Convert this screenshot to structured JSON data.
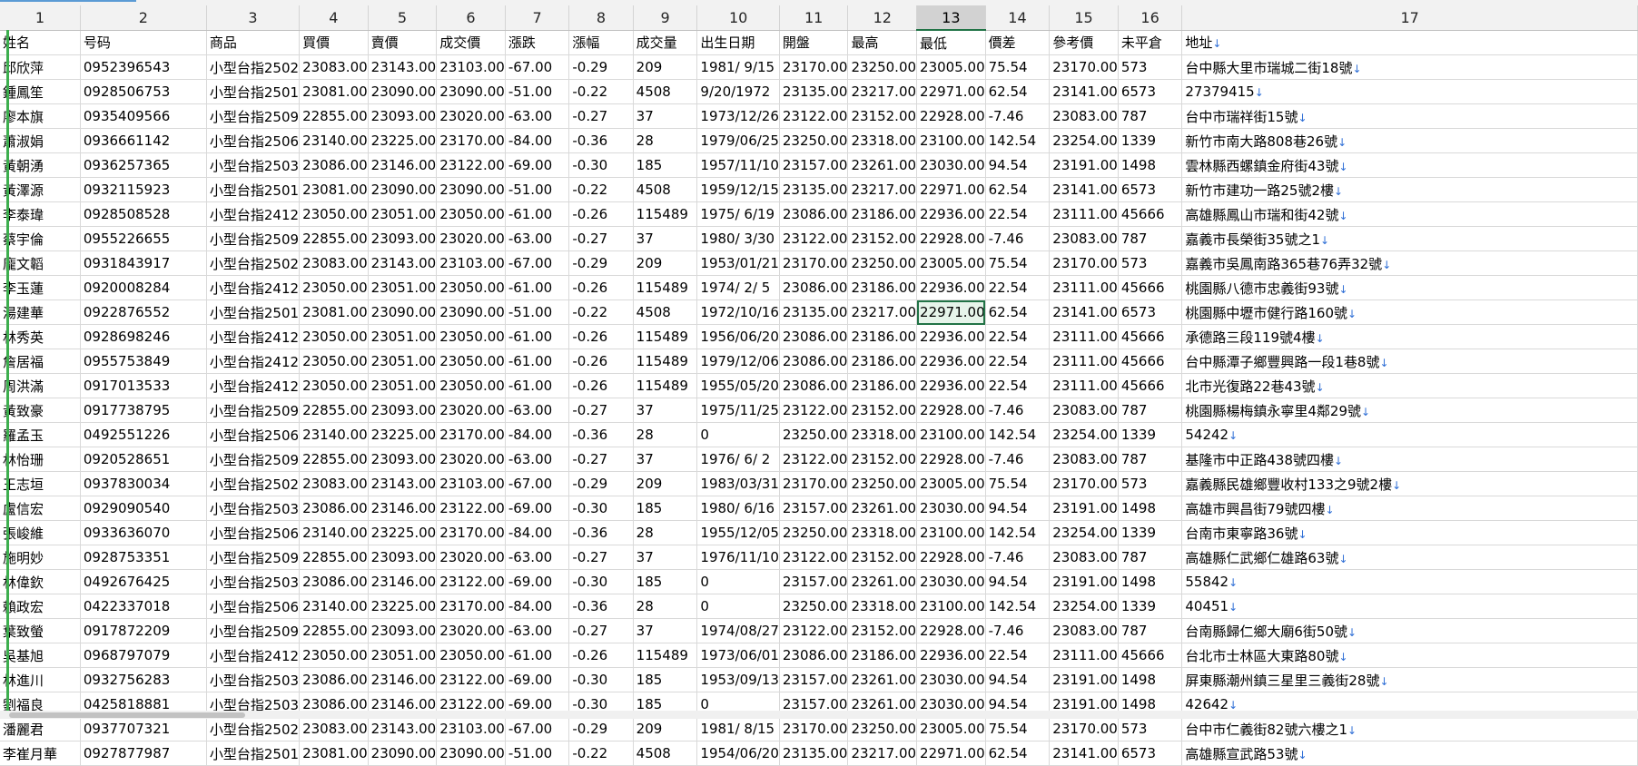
{
  "column_numbers": [
    "1",
    "2",
    "3",
    "4",
    "5",
    "6",
    "7",
    "8",
    "9",
    "10",
    "11",
    "12",
    "13",
    "14",
    "15",
    "16",
    "17"
  ],
  "selected_column": 12,
  "selected_cell": {
    "row": 10,
    "col": 12
  },
  "header_row": [
    "姓名",
    "号码",
    "商品",
    "買價",
    "賣價",
    "成交價",
    "漲跌",
    "漲幅",
    "成交量",
    "出生日期",
    "開盤",
    "最高",
    "最低",
    "價差",
    "參考價",
    "未平倉",
    "地址"
  ],
  "rows": [
    [
      "邱欣萍",
      "0952396543",
      "小型台指2502",
      "23083.00",
      "23143.00",
      "23103.00",
      "-67.00",
      "-0.29",
      "209",
      "1981/ 9/15",
      "23170.00",
      "23250.00",
      "23005.00",
      "75.54",
      "23170.00",
      "573",
      "台中縣大里市瑞城二街18號"
    ],
    [
      "鍾鳳笙",
      "0928506753",
      "小型台指2501",
      "23081.00",
      "23090.00",
      "23090.00",
      "-51.00",
      "-0.22",
      "4508",
      "9/20/1972",
      "23135.00",
      "23217.00",
      "22971.00",
      "62.54",
      "23141.00",
      "6573",
      "27379415"
    ],
    [
      "廖本旗",
      "0935409566",
      "小型台指2509",
      "22855.00",
      "23093.00",
      "23020.00",
      "-63.00",
      "-0.27",
      "37",
      "1973/12/26",
      "23122.00",
      "23152.00",
      "22928.00",
      "-7.46",
      "23083.00",
      "787",
      "台中市瑞祥街15號"
    ],
    [
      "蕭淑娟",
      "0936661142",
      "小型台指2506",
      "23140.00",
      "23225.00",
      "23170.00",
      "-84.00",
      "-0.36",
      "28",
      "1979/06/25",
      "23250.00",
      "23318.00",
      "23100.00",
      "142.54",
      "23254.00",
      "1339",
      "新竹市南大路808巷26號"
    ],
    [
      "黃朝湧",
      "0936257365",
      "小型台指2503",
      "23086.00",
      "23146.00",
      "23122.00",
      "-69.00",
      "-0.30",
      "185",
      "1957/11/10",
      "23157.00",
      "23261.00",
      "23030.00",
      "94.54",
      "23191.00",
      "1498",
      "雲林縣西螺鎮金府街43號"
    ],
    [
      "黃澤源",
      "0932115923",
      "小型台指2501",
      "23081.00",
      "23090.00",
      "23090.00",
      "-51.00",
      "-0.22",
      "4508",
      "1959/12/15",
      "23135.00",
      "23217.00",
      "22971.00",
      "62.54",
      "23141.00",
      "6573",
      "新竹市建功一路25號2樓"
    ],
    [
      "李泰瑋",
      "0928508528",
      "小型台指2412",
      "23050.00",
      "23051.00",
      "23050.00",
      "-61.00",
      "-0.26",
      "115489",
      "1975/ 6/19",
      "23086.00",
      "23186.00",
      "22936.00",
      "22.54",
      "23111.00",
      "45666",
      "高雄縣鳳山市瑞和街42號"
    ],
    [
      "蔡宇倫",
      "0955226655",
      "小型台指2509",
      "22855.00",
      "23093.00",
      "23020.00",
      "-63.00",
      "-0.27",
      "37",
      "1980/ 3/30",
      "23122.00",
      "23152.00",
      "22928.00",
      "-7.46",
      "23083.00",
      "787",
      "嘉義市長榮街35號之1"
    ],
    [
      "龐文韜",
      "0931843917",
      "小型台指2502",
      "23083.00",
      "23143.00",
      "23103.00",
      "-67.00",
      "-0.29",
      "209",
      "1953/01/21",
      "23170.00",
      "23250.00",
      "23005.00",
      "75.54",
      "23170.00",
      "573",
      "嘉義市吳鳳南路365巷76弄32號"
    ],
    [
      "李玉蓮",
      "0920008284",
      "小型台指2412",
      "23050.00",
      "23051.00",
      "23050.00",
      "-61.00",
      "-0.26",
      "115489",
      "1974/ 2/ 5",
      "23086.00",
      "23186.00",
      "22936.00",
      "22.54",
      "23111.00",
      "45666",
      "桃園縣八德市忠義街93號"
    ],
    [
      "湯建華",
      "0922876552",
      "小型台指2501",
      "23081.00",
      "23090.00",
      "23090.00",
      "-51.00",
      "-0.22",
      "4508",
      "1972/10/16",
      "23135.00",
      "23217.00",
      "22971.00",
      "62.54",
      "23141.00",
      "6573",
      "桃園縣中壢市健行路160號"
    ],
    [
      "林秀英",
      "0928698246",
      "小型台指2412",
      "23050.00",
      "23051.00",
      "23050.00",
      "-61.00",
      "-0.26",
      "115489",
      "1956/06/20",
      "23086.00",
      "23186.00",
      "22936.00",
      "22.54",
      "23111.00",
      "45666",
      "承德路三段119號4樓"
    ],
    [
      "詹居福",
      "0955753849",
      "小型台指2412",
      "23050.00",
      "23051.00",
      "23050.00",
      "-61.00",
      "-0.26",
      "115489",
      "1979/12/06",
      "23086.00",
      "23186.00",
      "22936.00",
      "22.54",
      "23111.00",
      "45666",
      "台中縣潭子鄉豐興路一段1巷8號"
    ],
    [
      "周洪滿",
      "0917013533",
      "小型台指2412",
      "23050.00",
      "23051.00",
      "23050.00",
      "-61.00",
      "-0.26",
      "115489",
      "1955/05/20",
      "23086.00",
      "23186.00",
      "22936.00",
      "22.54",
      "23111.00",
      "45666",
      "北市光復路22巷43號"
    ],
    [
      "黃致豪",
      "0917738795",
      "小型台指2509",
      "22855.00",
      "23093.00",
      "23020.00",
      "-63.00",
      "-0.27",
      "37",
      "1975/11/25",
      "23122.00",
      "23152.00",
      "22928.00",
      "-7.46",
      "23083.00",
      "787",
      "桃園縣楊梅鎮永寧里4鄰29號"
    ],
    [
      "羅孟玉",
      "0492551226",
      "小型台指2506",
      "23140.00",
      "23225.00",
      "23170.00",
      "-84.00",
      "-0.36",
      "28",
      "0",
      "23250.00",
      "23318.00",
      "23100.00",
      "142.54",
      "23254.00",
      "1339",
      "54242"
    ],
    [
      "林怡珊",
      "0920528651",
      "小型台指2509",
      "22855.00",
      "23093.00",
      "23020.00",
      "-63.00",
      "-0.27",
      "37",
      "1976/ 6/ 2",
      "23122.00",
      "23152.00",
      "22928.00",
      "-7.46",
      "23083.00",
      "787",
      "基隆市中正路438號四樓"
    ],
    [
      "王志垣",
      "0937830034",
      "小型台指2502",
      "23083.00",
      "23143.00",
      "23103.00",
      "-67.00",
      "-0.29",
      "209",
      "1983/03/31",
      "23170.00",
      "23250.00",
      "23005.00",
      "75.54",
      "23170.00",
      "573",
      "嘉義縣民雄鄉豐收村133之9號2樓"
    ],
    [
      "盧信宏",
      "0929090540",
      "小型台指2503",
      "23086.00",
      "23146.00",
      "23122.00",
      "-69.00",
      "-0.30",
      "185",
      "1980/ 6/16",
      "23157.00",
      "23261.00",
      "23030.00",
      "94.54",
      "23191.00",
      "1498",
      "高雄市興昌街79號四樓"
    ],
    [
      "張峻維",
      "0933636070",
      "小型台指2506",
      "23140.00",
      "23225.00",
      "23170.00",
      "-84.00",
      "-0.36",
      "28",
      "1955/12/05",
      "23250.00",
      "23318.00",
      "23100.00",
      "142.54",
      "23254.00",
      "1339",
      "台南市東寧路36號"
    ],
    [
      "施明妙",
      "0928753351",
      "小型台指2509",
      "22855.00",
      "23093.00",
      "23020.00",
      "-63.00",
      "-0.27",
      "37",
      "1976/11/10",
      "23122.00",
      "23152.00",
      "22928.00",
      "-7.46",
      "23083.00",
      "787",
      "高雄縣仁武鄉仁雄路63號"
    ],
    [
      "林偉欽",
      "0492676425",
      "小型台指2503",
      "23086.00",
      "23146.00",
      "23122.00",
      "-69.00",
      "-0.30",
      "185",
      "0",
      "23157.00",
      "23261.00",
      "23030.00",
      "94.54",
      "23191.00",
      "1498",
      "55842"
    ],
    [
      "賴政宏",
      "0422337018",
      "小型台指2506",
      "23140.00",
      "23225.00",
      "23170.00",
      "-84.00",
      "-0.36",
      "28",
      "0",
      "23250.00",
      "23318.00",
      "23100.00",
      "142.54",
      "23254.00",
      "1339",
      "40451"
    ],
    [
      "葉致螢",
      "0917872209",
      "小型台指2509",
      "22855.00",
      "23093.00",
      "23020.00",
      "-63.00",
      "-0.27",
      "37",
      "1974/08/27",
      "23122.00",
      "23152.00",
      "22928.00",
      "-7.46",
      "23083.00",
      "787",
      "台南縣歸仁鄉大廟6街50號"
    ],
    [
      "吳基旭",
      "0968797079",
      "小型台指2412",
      "23050.00",
      "23051.00",
      "23050.00",
      "-61.00",
      "-0.26",
      "115489",
      "1973/06/01",
      "23086.00",
      "23186.00",
      "22936.00",
      "22.54",
      "23111.00",
      "45666",
      "台北市士林區大東路80號"
    ],
    [
      "林進川",
      "0932756283",
      "小型台指2503",
      "23086.00",
      "23146.00",
      "23122.00",
      "-69.00",
      "-0.30",
      "185",
      "1953/09/13",
      "23157.00",
      "23261.00",
      "23030.00",
      "94.54",
      "23191.00",
      "1498",
      "屏東縣潮州鎮三星里三義街28號"
    ],
    [
      "劉福良",
      "0425818881",
      "小型台指2503",
      "23086.00",
      "23146.00",
      "23122.00",
      "-69.00",
      "-0.30",
      "185",
      "0",
      "23157.00",
      "23261.00",
      "23030.00",
      "94.54",
      "23191.00",
      "1498",
      "42642"
    ],
    [
      "潘麗君",
      "0937707321",
      "小型台指2502",
      "23083.00",
      "23143.00",
      "23103.00",
      "-67.00",
      "-0.29",
      "209",
      "1981/ 8/15",
      "23170.00",
      "23250.00",
      "23005.00",
      "75.54",
      "23170.00",
      "573",
      "台中市仁義街82號六樓之1"
    ],
    [
      "李崔月華",
      "0927877987",
      "小型台指2501",
      "23081.00",
      "23090.00",
      "23090.00",
      "-51.00",
      "-0.22",
      "4508",
      "1954/06/20",
      "23135.00",
      "23217.00",
      "22971.00",
      "62.54",
      "23141.00",
      "6573",
      "高雄縣宣武路53號"
    ]
  ],
  "cell_end_glyph": "↓",
  "colors": {
    "accent": "#217346",
    "row_marker": "#3dae4e",
    "line_break_glyph": "#2f6fd6",
    "header_bg": "#f2f2f2"
  }
}
